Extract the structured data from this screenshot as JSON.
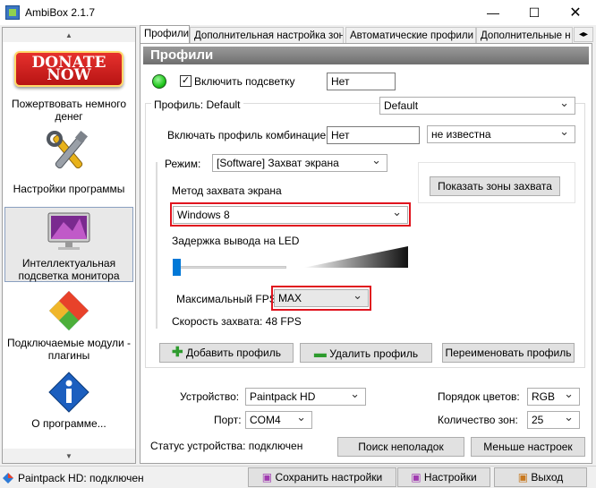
{
  "window": {
    "title": "AmbiBox 2.1.7"
  },
  "sidebar": {
    "items": [
      {
        "label": "Пожертвовать немного денег",
        "badge": "DONATE NOW"
      },
      {
        "label": "Настройки программы"
      },
      {
        "label": "Интеллектуальная подсветка монитора"
      },
      {
        "label": "Подключаемые модули - плагины"
      },
      {
        "label": "О программе..."
      }
    ]
  },
  "tabs": [
    "Профили",
    "Дополнительная настройка зон",
    "Автоматические профили",
    "Дополнительные н"
  ],
  "panel": {
    "title": "Профили",
    "enable_label": "Включить подсветку",
    "enable_checked": true,
    "enable_value": "Нет",
    "profile_label": "Профиль: Default",
    "profile_value": "Default",
    "combo_label": "Включать профиль комбинацией:",
    "combo_value": "Нет",
    "combo_state": "не известна",
    "mode_label": "Режим:",
    "mode_value": "[Software] Захват экрана",
    "capture_method_label": "Метод захвата экрана",
    "capture_method_value": "Windows 8",
    "show_zones_button": "Показать зоны захвата",
    "delay_label": "Задержка вывода на LED",
    "delay_level": 0.0,
    "max_fps_label": "Максимальный FPS",
    "max_fps_value": "MAX",
    "capture_speed": "Скорость захвата: 48 FPS",
    "add_profile": "Добавить профиль",
    "delete_profile": "Удалить профиль",
    "rename_profile": "Переименовать профиль",
    "device_label": "Устройство:",
    "device_value": "Paintpack HD",
    "port_label": "Порт:",
    "port_value": "COM4",
    "color_order_label": "Порядок цветов:",
    "color_order_value": "RGB",
    "zones_count_label": "Количество зон:",
    "zones_count_value": "25",
    "device_status": "Статус устройства: подключен",
    "troubleshoot_button": "Поиск неполадок",
    "fewer_settings_button": "Меньше настроек"
  },
  "statusbar": {
    "status": "Paintpack HD: подключен",
    "save_button": "Сохранить настройки",
    "settings_button": "Настройки",
    "exit_button": "Выход"
  },
  "colors": {
    "highlight": "#e0141e",
    "indicator": "#22c81e"
  }
}
